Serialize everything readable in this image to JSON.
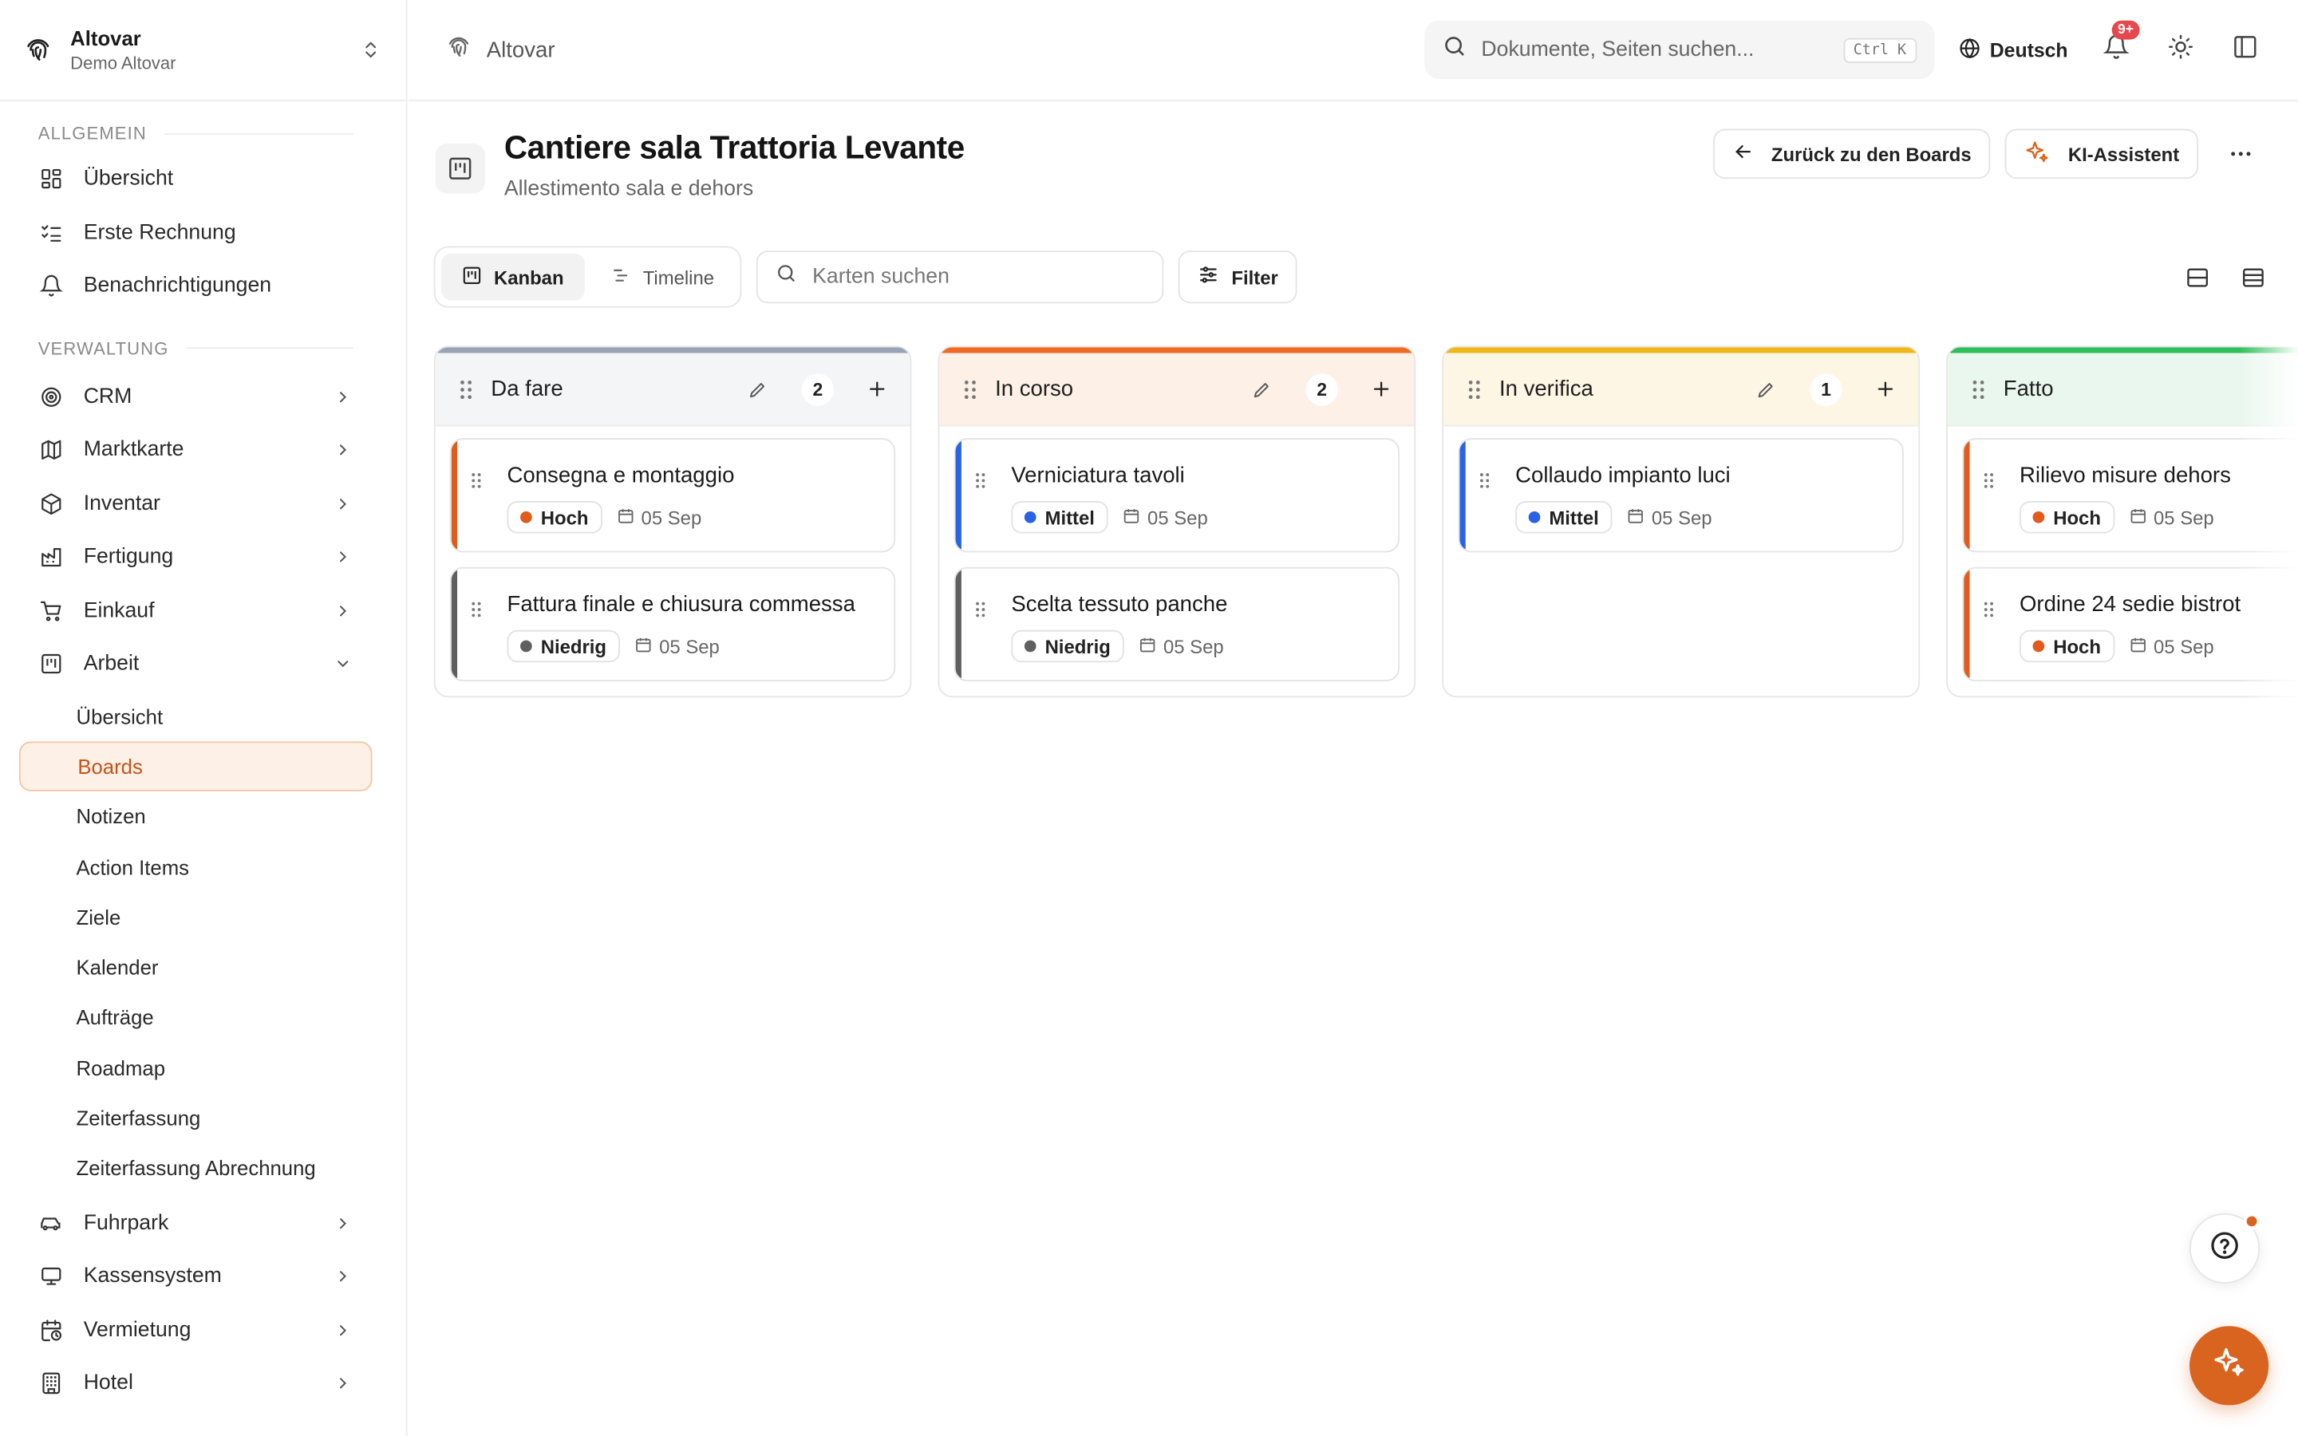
{
  "org": {
    "name": "Altovar",
    "subtitle": "Demo Altovar"
  },
  "sidebar": {
    "section_general": "ALLGEMEIN",
    "general_items": [
      {
        "label": "Übersicht",
        "icon": "grid-icon"
      },
      {
        "label": "Erste Rechnung",
        "icon": "checklist-icon"
      },
      {
        "label": "Benachrichtigungen",
        "icon": "bell-icon"
      }
    ],
    "section_admin": "VERWALTUNG",
    "admin_items": [
      {
        "label": "CRM",
        "icon": "target-icon"
      },
      {
        "label": "Marktkarte",
        "icon": "map-icon"
      },
      {
        "label": "Inventar",
        "icon": "package-icon"
      },
      {
        "label": "Fertigung",
        "icon": "factory-icon"
      },
      {
        "label": "Einkauf",
        "icon": "cart-icon"
      },
      {
        "label": "Arbeit",
        "icon": "kanban-icon"
      }
    ],
    "work_sub_items": [
      {
        "label": "Übersicht"
      },
      {
        "label": "Boards",
        "active": true
      },
      {
        "label": "Notizen"
      },
      {
        "label": "Action Items"
      },
      {
        "label": "Ziele"
      },
      {
        "label": "Kalender"
      },
      {
        "label": "Aufträge"
      },
      {
        "label": "Roadmap"
      },
      {
        "label": "Zeiterfassung"
      },
      {
        "label": "Zeiterfassung Abrechnung"
      }
    ],
    "more_items": [
      {
        "label": "Fuhrpark",
        "icon": "car-icon"
      },
      {
        "label": "Kassensystem",
        "icon": "monitor-icon"
      },
      {
        "label": "Vermietung",
        "icon": "calendar-clock-icon"
      },
      {
        "label": "Hotel",
        "icon": "building-icon"
      }
    ]
  },
  "topbar": {
    "breadcrumb": "Altovar",
    "search_placeholder": "Dokumente, Seiten suchen...",
    "search_shortcut": "Ctrl K",
    "language": "Deutsch",
    "notification_badge": "9+"
  },
  "page": {
    "title": "Cantiere sala Trattoria Levante",
    "subtitle": "Allestimento sala e dehors",
    "back_button": "Zurück zu den Boards",
    "ai_button": "KI-Assistent"
  },
  "toolbar": {
    "view_kanban": "Kanban",
    "view_timeline": "Timeline",
    "card_search_placeholder": "Karten suchen",
    "filter_label": "Filter"
  },
  "columns": [
    {
      "title": "Da fare",
      "count": "2",
      "accent": "#9aa3b5",
      "head_bg": "#f4f5f7",
      "cards": [
        {
          "title": "Consegna e montaggio",
          "priority": "Hoch",
          "priority_color": "#e25a1c",
          "stripe": "#e25a1c",
          "date": "05 Sep"
        },
        {
          "title": "Fattura finale e chiusura commessa",
          "priority": "Niedrig",
          "priority_color": "#5f5f5f",
          "stripe": "#5f5f5f",
          "date": "05 Sep"
        }
      ]
    },
    {
      "title": "In corso",
      "count": "2",
      "accent": "#ef6a23",
      "head_bg": "#fdf0e6",
      "cards": [
        {
          "title": "Verniciatura tavoli",
          "priority": "Mittel",
          "priority_color": "#2a62e6",
          "stripe": "#2a62e6",
          "date": "05 Sep"
        },
        {
          "title": "Scelta tessuto panche",
          "priority": "Niedrig",
          "priority_color": "#5f5f5f",
          "stripe": "#5f5f5f",
          "date": "05 Sep"
        }
      ]
    },
    {
      "title": "In verifica",
      "count": "1",
      "accent": "#f0b71a",
      "head_bg": "#fdf6e4",
      "cards": [
        {
          "title": "Collaudo impianto luci",
          "priority": "Mittel",
          "priority_color": "#2a62e6",
          "stripe": "#2a62e6",
          "date": "05 Sep"
        }
      ]
    },
    {
      "title": "Fatto",
      "count": "",
      "accent": "#2fbf5a",
      "head_bg": "#eaf7ee",
      "cards": [
        {
          "title": "Rilievo misure dehors",
          "priority": "Hoch",
          "priority_color": "#e25a1c",
          "stripe": "#e25a1c",
          "date": "05 Sep"
        },
        {
          "title": "Ordine 24 sedie bistrot",
          "priority": "Hoch",
          "priority_color": "#e25a1c",
          "stripe": "#e25a1c",
          "date": "05 Sep"
        }
      ]
    }
  ]
}
